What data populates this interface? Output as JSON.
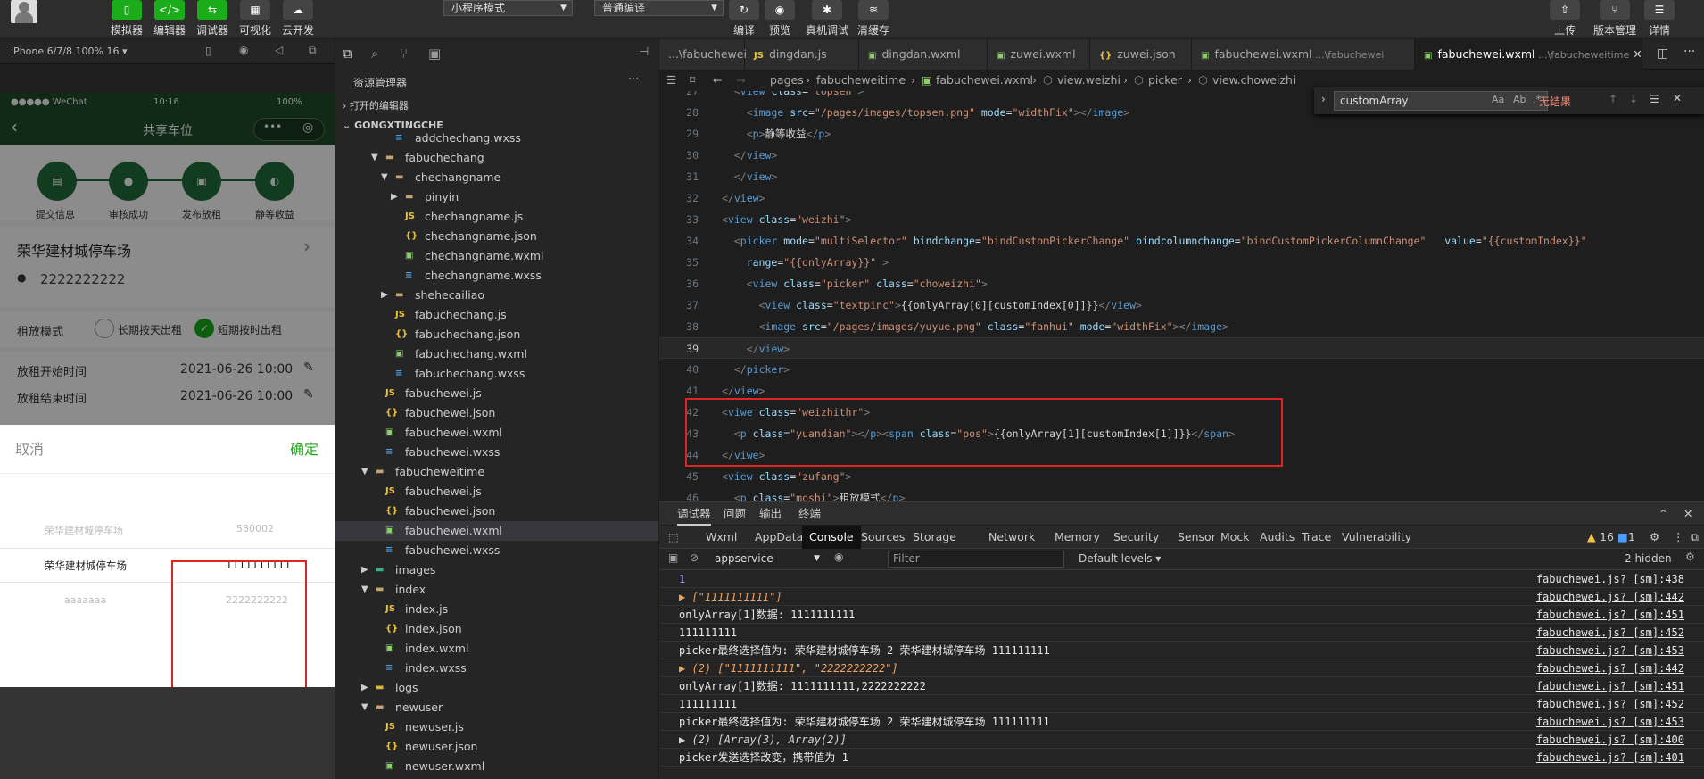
{
  "toolbar": {
    "avatar": "",
    "buttons": [
      {
        "label": "模拟器",
        "icon": "phone-icon"
      },
      {
        "label": "编辑器",
        "icon": "code-icon"
      },
      {
        "label": "调试器",
        "icon": "debug-icon"
      },
      {
        "label": "可视化",
        "icon": "layout-icon"
      },
      {
        "label": "云开发",
        "icon": "cloud-icon"
      }
    ],
    "mode_select": "小程序模式",
    "compile_select": "普通编译",
    "actions": [
      "编译",
      "预览",
      "真机调试",
      "清缓存"
    ],
    "right": [
      "上传",
      "版本管理",
      "详情"
    ]
  },
  "simulator": {
    "device": "iPhone 6/7/8 100% 16 ▾",
    "status_carrier": "●●●●● WeChat",
    "status_time": "10:16",
    "status_battery": "100%",
    "nav_title": "共享车位",
    "steps": [
      "提交信息",
      "审核成功",
      "发布放租",
      "静等收益"
    ],
    "lot_name": "荣华建材城停车场",
    "lot_number": "2222222222",
    "mode_label": "租放模式",
    "mode_opt1": "长期按天出租",
    "mode_opt2": "短期按时出租",
    "start_label": "放租开始时间",
    "start_value": "2021-06-26 10:00",
    "end_label": "放租结束时间",
    "end_value": "2021-06-26 10:00",
    "picker": {
      "cancel": "取消",
      "confirm": "确定",
      "col1": [
        "荣华建材城停车场",
        "荣华建材城停车场",
        "aaaaaaa"
      ],
      "col2": [
        "580002",
        "1111111111",
        "2222222222"
      ]
    }
  },
  "explorer": {
    "title": "资源管理器",
    "more": "···",
    "open_editors": "打开的编辑器",
    "project": "GONGXTINGCHE",
    "items": [
      {
        "label": "addchechang.wxss",
        "type": "wxss",
        "depth": 3,
        "partial": true
      },
      {
        "label": "fabuchechang",
        "type": "folder-open",
        "depth": 2
      },
      {
        "label": "chechangname",
        "type": "folder-open",
        "depth": 3
      },
      {
        "label": "pinyin",
        "type": "folder",
        "depth": 4
      },
      {
        "label": "chechangname.js",
        "type": "js",
        "depth": 4
      },
      {
        "label": "chechangname.json",
        "type": "json",
        "depth": 4
      },
      {
        "label": "chechangname.wxml",
        "type": "wxml",
        "depth": 4
      },
      {
        "label": "chechangname.wxss",
        "type": "wxss",
        "depth": 4
      },
      {
        "label": "shehecailiao",
        "type": "folder",
        "depth": 3
      },
      {
        "label": "fabuchechang.js",
        "type": "js",
        "depth": 3
      },
      {
        "label": "fabuchechang.json",
        "type": "json",
        "depth": 3
      },
      {
        "label": "fabuchechang.wxml",
        "type": "wxml",
        "depth": 3
      },
      {
        "label": "fabuchechang.wxss",
        "type": "wxss",
        "depth": 3
      },
      {
        "label": "fabuchewei.js",
        "type": "js",
        "depth": 2
      },
      {
        "label": "fabuchewei.json",
        "type": "json",
        "depth": 2
      },
      {
        "label": "fabuchewei.wxml",
        "type": "wxml",
        "depth": 2
      },
      {
        "label": "fabuchewei.wxss",
        "type": "wxss",
        "depth": 2
      },
      {
        "label": "fabucheweitime",
        "type": "folder-open",
        "depth": 1
      },
      {
        "label": "fabuchewei.js",
        "type": "js",
        "depth": 2
      },
      {
        "label": "fabuchewei.json",
        "type": "json",
        "depth": 2
      },
      {
        "label": "fabuchewei.wxml",
        "type": "wxml",
        "depth": 2,
        "selected": true
      },
      {
        "label": "fabuchewei.wxss",
        "type": "wxss",
        "depth": 2
      },
      {
        "label": "images",
        "type": "folder-img",
        "depth": 1
      },
      {
        "label": "index",
        "type": "folder-open",
        "depth": 1
      },
      {
        "label": "index.js",
        "type": "js",
        "depth": 2
      },
      {
        "label": "index.json",
        "type": "json",
        "depth": 2
      },
      {
        "label": "index.wxml",
        "type": "wxml",
        "depth": 2
      },
      {
        "label": "index.wxss",
        "type": "wxss",
        "depth": 2
      },
      {
        "label": "logs",
        "type": "folder-log",
        "depth": 1
      },
      {
        "label": "newuser",
        "type": "folder-open",
        "depth": 1
      },
      {
        "label": "newuser.js",
        "type": "js",
        "depth": 2
      },
      {
        "label": "newuser.json",
        "type": "json",
        "depth": 2
      },
      {
        "label": "newuser.wxml",
        "type": "wxml",
        "depth": 2
      }
    ]
  },
  "editor": {
    "tabs": [
      {
        "label": "...\\fabuchewei",
        "type": "none"
      },
      {
        "label": "dingdan.js",
        "type": "js"
      },
      {
        "label": "dingdan.wxml",
        "type": "wxml"
      },
      {
        "label": "zuwei.wxml",
        "type": "wxml"
      },
      {
        "label": "zuwei.json",
        "type": "json"
      },
      {
        "label": "fabuchewei.wxml",
        "sub": "...\\fabuchewei",
        "type": "wxml"
      },
      {
        "label": "fabuchewei.wxml",
        "sub": "...\\fabucheweitime",
        "type": "wxml",
        "active": true
      }
    ],
    "breadcrumb": [
      "pages",
      "fabucheweitime",
      "fabuchewei.wxml",
      "view.weizhi",
      "picker",
      "view.choweizhi"
    ],
    "find": {
      "value": "customArray",
      "result": "无结果"
    },
    "lines": [
      {
        "n": "27",
        "h": "  <view class=\"topsen\">"
      },
      {
        "n": "28",
        "h": "    <image src=\"/pages/images/topsen.png\" mode=\"widthFix\"></image>"
      },
      {
        "n": "29",
        "h": "    <p>静等收益</p>"
      },
      {
        "n": "30",
        "h": "  </view>"
      },
      {
        "n": "31",
        "h": "  </view>"
      },
      {
        "n": "32",
        "h": "</view>"
      },
      {
        "n": "33",
        "h": "<view class=\"weizhi\">"
      },
      {
        "n": "34",
        "h": "  <picker mode=\"multiSelector\" bindchange=\"bindCustomPickerChange\" bindcolumnchange=\"bindCustomPickerColumnChange\"   value=\"{{customIndex}}\""
      },
      {
        "n": "35",
        "h": "    range=\"{{onlyArray}}\" >"
      },
      {
        "n": "36",
        "h": "    <view class=\"picker\" class=\"choweizhi\">"
      },
      {
        "n": "37",
        "h": "      <view class=\"textpinc\">{{onlyArray[0][customIndex[0]]}}</view>"
      },
      {
        "n": "38",
        "h": "      <image src=\"/pages/images/yuyue.png\" class=\"fanhui\" mode=\"widthFix\"></image>"
      },
      {
        "n": "39",
        "h": "    </view>",
        "cur": true
      },
      {
        "n": "40",
        "h": "  </picker>"
      },
      {
        "n": "41",
        "h": "</view>"
      },
      {
        "n": "42",
        "h": "<viwe class=\"weizhithr\">"
      },
      {
        "n": "43",
        "h": "  <p class=\"yuandian\"></p><span class=\"pos\">{{onlyArray[1][customIndex[1]]}}</span>"
      },
      {
        "n": "44",
        "h": "</viwe>"
      },
      {
        "n": "45",
        "h": "<view class=\"zufang\">"
      },
      {
        "n": "46",
        "h": "  <p class=\"moshi\">租放模式</p>"
      }
    ]
  },
  "devtools": {
    "top_tabs": [
      "调试器",
      "问题",
      "输出",
      "终端"
    ],
    "tabs": [
      "Wxml",
      "AppData",
      "Console",
      "Sources",
      "Storage",
      "Network",
      "Memory",
      "Security",
      "Sensor",
      "Mock",
      "Audits",
      "Trace",
      "Vulnerability"
    ],
    "active_tab": "Console",
    "warn_count": "16",
    "info_count": "1",
    "context": "appservice",
    "filter_placeholder": "Filter",
    "levels": "Default levels ▾",
    "hidden": "2 hidden",
    "console": [
      {
        "msg": "1",
        "src": "fabuchewei.js? [sm]:438",
        "kind": "num"
      },
      {
        "msg": "▶ [\"1111111111\"]",
        "src": "fabuchewei.js? [sm]:442",
        "kind": "arr"
      },
      {
        "msg": "onlyArray[1]数据: 1111111111",
        "src": "fabuchewei.js? [sm]:451",
        "kind": "txt"
      },
      {
        "msg": "111111111",
        "src": "fabuchewei.js? [sm]:452",
        "kind": "txt"
      },
      {
        "msg": "picker最终选择值为:  荣华建材城停车场 2 荣华建材城停车场 111111111",
        "src": "fabuchewei.js? [sm]:453",
        "kind": "txt"
      },
      {
        "msg": "▶ (2) [\"1111111111\", \"2222222222\"]",
        "src": "fabuchewei.js? [sm]:442",
        "kind": "arr"
      },
      {
        "msg": "onlyArray[1]数据: 1111111111,2222222222",
        "src": "fabuchewei.js? [sm]:451",
        "kind": "txt"
      },
      {
        "msg": "111111111",
        "src": "fabuchewei.js? [sm]:452",
        "kind": "txt"
      },
      {
        "msg": "picker最终选择值为:  荣华建材城停车场 2 荣华建材城停车场 111111111",
        "src": "fabuchewei.js? [sm]:453",
        "kind": "txt"
      },
      {
        "msg": "▶ (2) [Array(3), Array(2)]",
        "src": "fabuchewei.js? [sm]:400",
        "kind": "arr2"
      },
      {
        "msg": "picker发送选择改变，携带值为 1",
        "src": "fabuchewei.js? [sm]:401",
        "kind": "txt"
      }
    ]
  }
}
